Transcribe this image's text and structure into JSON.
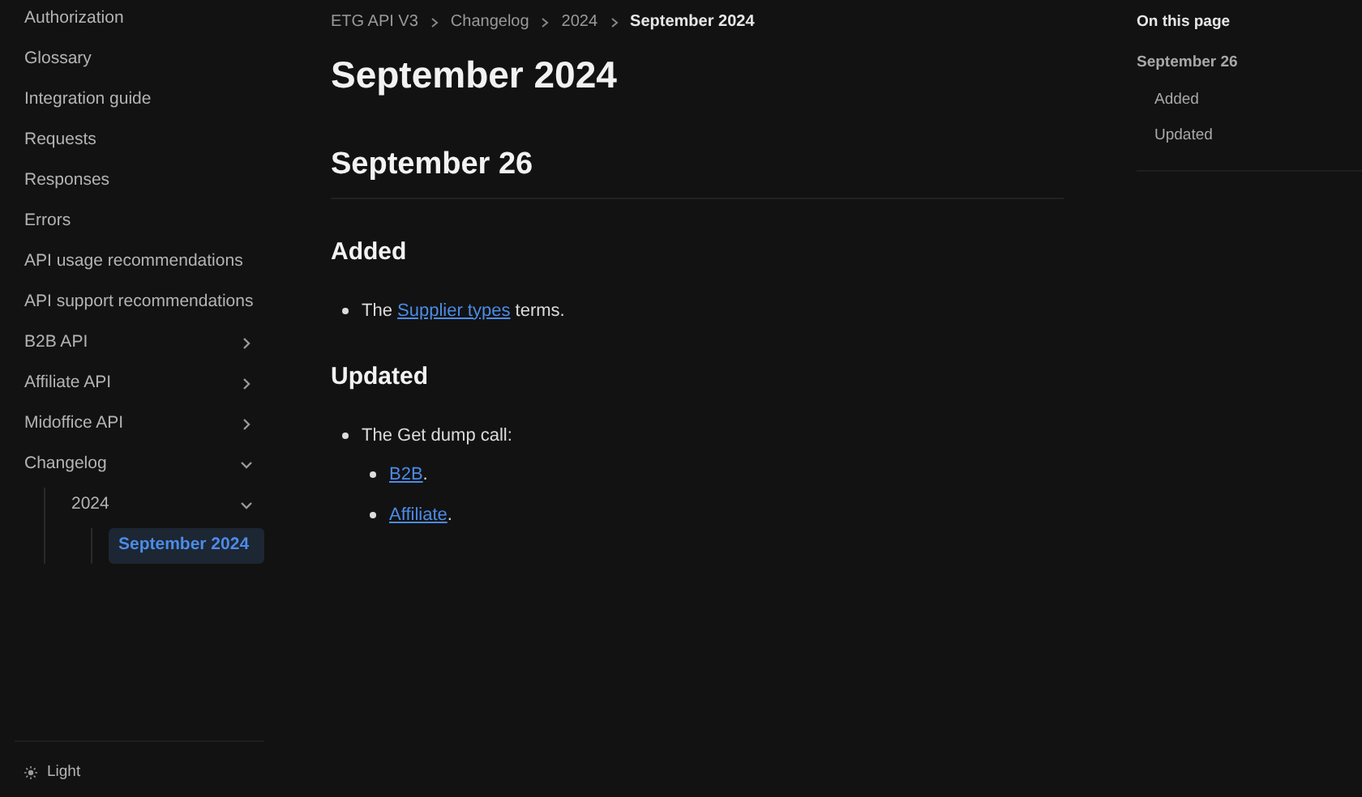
{
  "sidebar": {
    "items": [
      {
        "label": "Authorization",
        "kind": "page",
        "selected": false
      },
      {
        "label": "Glossary",
        "kind": "page",
        "selected": false
      },
      {
        "label": "Integration guide",
        "kind": "page",
        "selected": false
      },
      {
        "label": "Requests",
        "kind": "page",
        "selected": false
      },
      {
        "label": "Responses",
        "kind": "page",
        "selected": false
      },
      {
        "label": "Errors",
        "kind": "page",
        "selected": false
      },
      {
        "label": "API usage recommendations",
        "kind": "page",
        "selected": false
      },
      {
        "label": "API support recommendations",
        "kind": "page",
        "selected": false
      },
      {
        "label": "B2B API",
        "kind": "group",
        "expanded": false,
        "selected": false
      },
      {
        "label": "Affiliate API",
        "kind": "group",
        "expanded": false,
        "selected": false
      },
      {
        "label": "Midoffice API",
        "kind": "group",
        "expanded": false,
        "selected": false
      },
      {
        "label": "Changelog",
        "kind": "group",
        "expanded": true,
        "selected": false,
        "children": [
          {
            "label": "2024",
            "kind": "group",
            "expanded": true,
            "selected": false,
            "children": [
              {
                "label": "September 2024",
                "kind": "page",
                "selected": true
              }
            ]
          }
        ]
      }
    ],
    "theme_toggle": "Light"
  },
  "breadcrumbs": [
    "ETG API V3",
    "Changelog",
    "2024",
    "September 2024"
  ],
  "title": "September 2024",
  "sections": [
    {
      "heading": "September 26",
      "subsections": [
        {
          "heading": "Added",
          "bullets": [
            {
              "parts": [
                {
                  "kind": "text",
                  "text": "The "
                },
                {
                  "kind": "link",
                  "text": "Supplier types"
                },
                {
                  "kind": "text",
                  "text": " terms."
                }
              ]
            }
          ]
        },
        {
          "heading": "Updated",
          "bullets": [
            {
              "parts": [
                {
                  "kind": "text",
                  "text": "The Get dump call:"
                }
              ],
              "children": [
                {
                  "parts": [
                    {
                      "kind": "link",
                      "text": "B2B"
                    },
                    {
                      "kind": "text",
                      "text": "."
                    }
                  ]
                },
                {
                  "parts": [
                    {
                      "kind": "link",
                      "text": "Affiliate"
                    },
                    {
                      "kind": "text",
                      "text": "."
                    }
                  ]
                }
              ]
            }
          ]
        }
      ]
    }
  ],
  "toc": {
    "title": "On this page",
    "items": [
      {
        "label": "September 26",
        "children": [
          {
            "label": "Added"
          },
          {
            "label": "Updated"
          }
        ]
      }
    ]
  }
}
